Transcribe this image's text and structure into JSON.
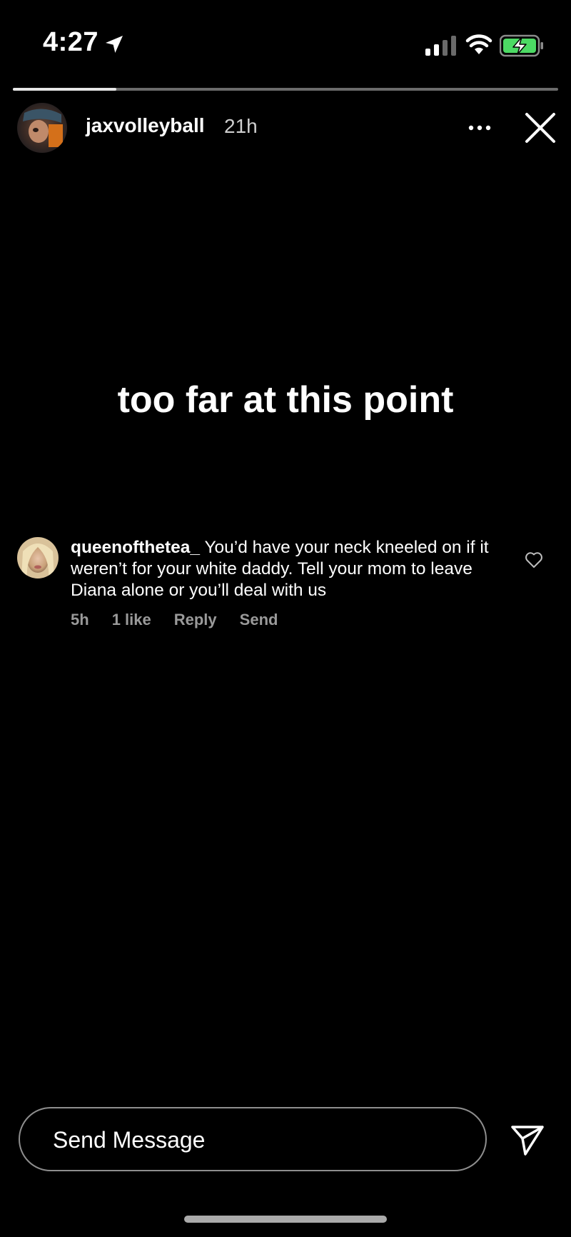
{
  "status_bar": {
    "time": "4:27",
    "icons": [
      "location-arrow-icon",
      "cellular-signal-icon",
      "wifi-icon",
      "battery-charging-icon"
    ],
    "battery_color": "#4cd964"
  },
  "story": {
    "progress_fraction": 0.19,
    "username": "jaxvolleyball",
    "age": "21h",
    "text": "too far at this point"
  },
  "comment": {
    "author": "queenofthetea_",
    "text": "You’d have your neck kneeled on if it weren’t for your white daddy. Tell your mom to leave Diana alone or you’ll deal with us",
    "time": "5h",
    "likes": "1 like",
    "reply_label": "Reply",
    "send_label": "Send"
  },
  "composer": {
    "placeholder": "Send Message"
  }
}
